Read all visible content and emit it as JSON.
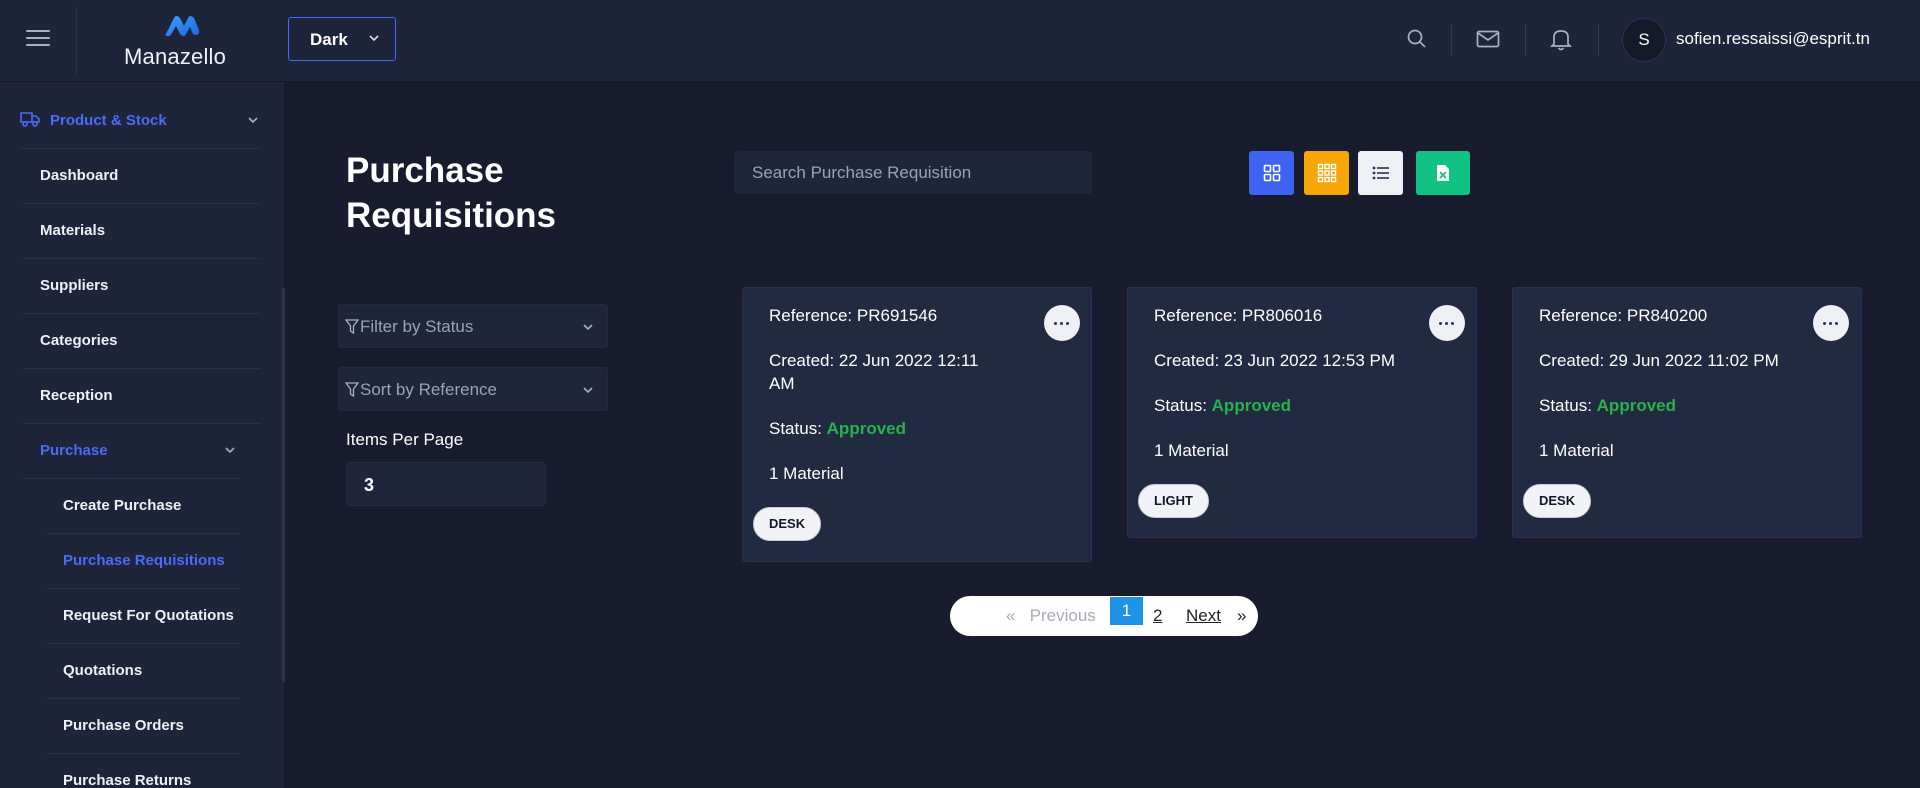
{
  "app": {
    "name": "Manazello"
  },
  "header": {
    "theme_label": "Dark",
    "user_initial": "S",
    "user_email": "sofien.ressaissi@esprit.tn"
  },
  "sidebar": {
    "section": "Product & Stock",
    "items": [
      {
        "label": "Dashboard"
      },
      {
        "label": "Materials"
      },
      {
        "label": "Suppliers"
      },
      {
        "label": "Categories"
      },
      {
        "label": "Reception"
      },
      {
        "label": "Purchase"
      }
    ],
    "purchase_children": [
      {
        "label": "Create Purchase"
      },
      {
        "label": "Purchase Requisitions"
      },
      {
        "label": "Request For Quotations"
      },
      {
        "label": "Quotations"
      },
      {
        "label": "Purchase Orders"
      },
      {
        "label": "Purchase Returns"
      }
    ]
  },
  "main": {
    "title_line1": "Purchase",
    "title_line2": "Requisitions",
    "search_placeholder": "Search Purchase Requisition",
    "filter_status_placeholder": "Filter by Status",
    "sort_placeholder": "Sort by Reference",
    "items_per_page_label": "Items Per Page",
    "items_per_page_value": "3",
    "view_buttons": [
      {
        "icon": "grid-2x2-icon",
        "color": "#3d63f0"
      },
      {
        "icon": "grid-3x3-icon",
        "color": "#f6a609"
      },
      {
        "icon": "list-icon",
        "color": "#eef0f6"
      },
      {
        "icon": "excel-icon",
        "color": "#12c282"
      }
    ]
  },
  "cards": [
    {
      "reference": "Reference: PR691546",
      "created_1": "Created: 22 Jun 2022 12:11",
      "created_2": "AM",
      "status_label": "Status:",
      "status_value": "Approved",
      "materials": "1 Material",
      "tag": "DESK"
    },
    {
      "reference": "Reference: PR806016",
      "created_1": "Created: 23 Jun 2022 12:53 PM",
      "status_label": "Status:",
      "status_value": "Approved",
      "materials": "1 Material",
      "tag": "LIGHT"
    },
    {
      "reference": "Reference: PR840200",
      "created_1": "Created: 29 Jun 2022 11:02 PM",
      "status_label": "Status:",
      "status_value": "Approved",
      "materials": "1 Material",
      "tag": "DESK"
    }
  ],
  "pagination": {
    "prev_arrow": "«",
    "previous": "Previous",
    "current": "1",
    "page2": "2",
    "next": "Next",
    "next_arrow": "»"
  },
  "colors": {
    "accent": "#4a6cf7",
    "approved": "#27b34a",
    "background": "#181c2e",
    "panel": "#1e2439"
  }
}
